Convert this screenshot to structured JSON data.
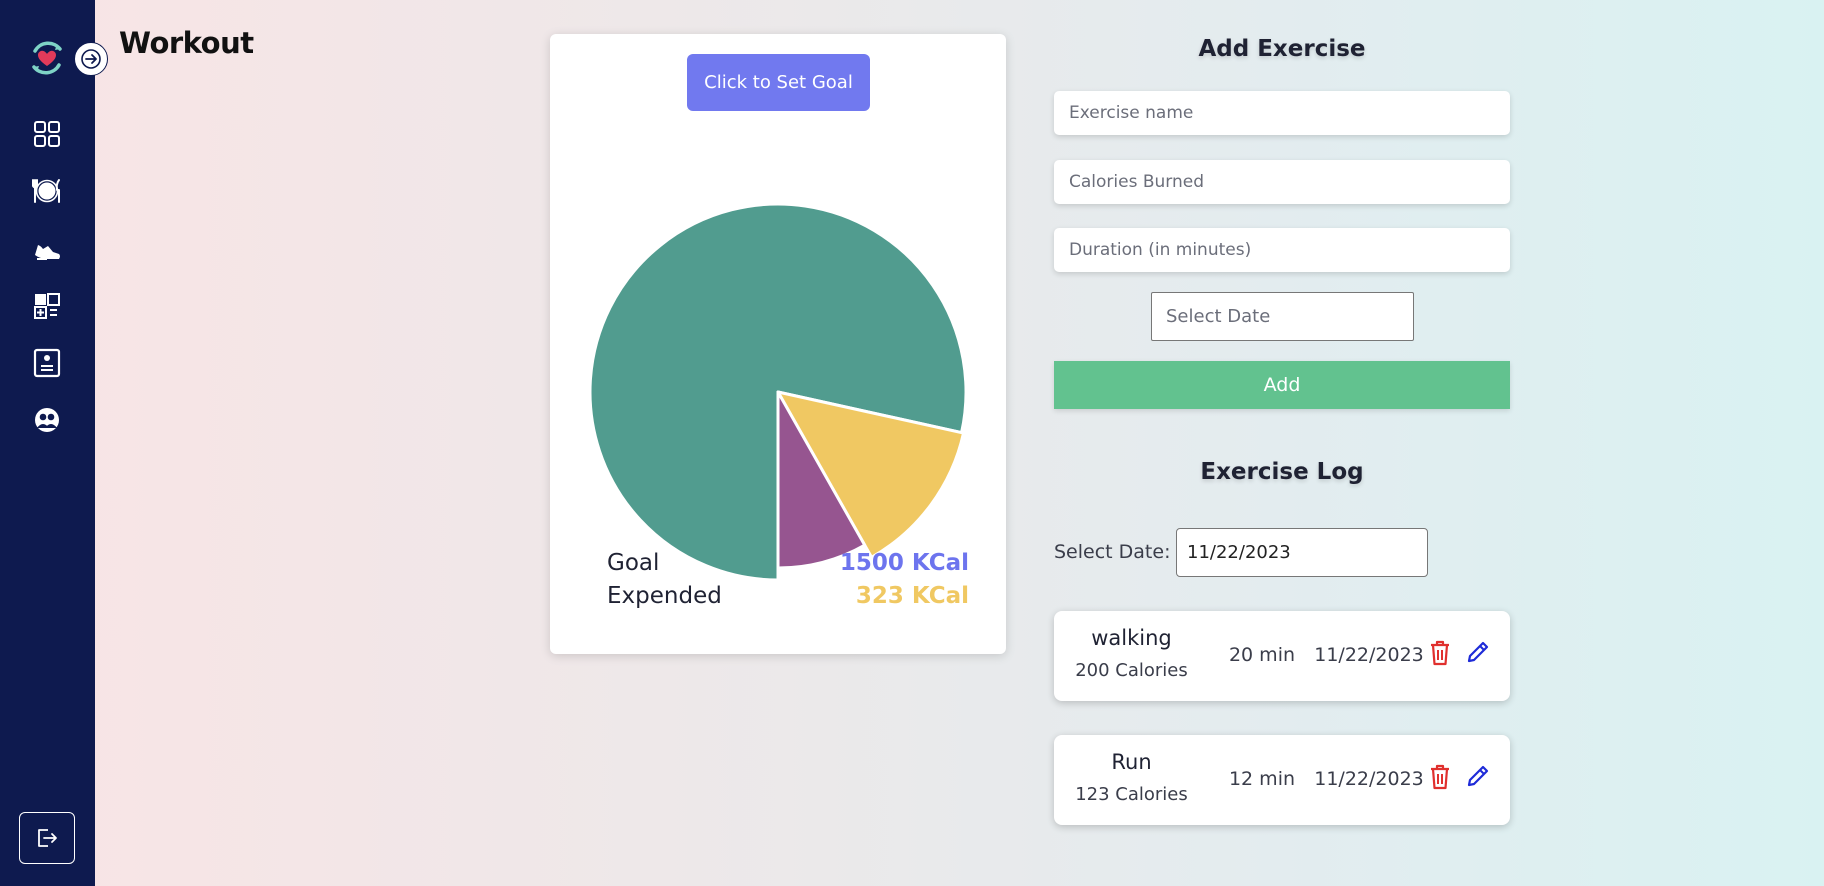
{
  "page": {
    "title": "Workout"
  },
  "sidebar": {
    "items": [
      {
        "name": "dashboard",
        "icon": "grid-icon"
      },
      {
        "name": "meals",
        "icon": "plate-cutlery-icon"
      },
      {
        "name": "workout",
        "icon": "sneaker-icon"
      },
      {
        "name": "calculator",
        "icon": "calculator-icon"
      },
      {
        "name": "profile",
        "icon": "id-card-icon"
      },
      {
        "name": "community",
        "icon": "group-icon"
      }
    ],
    "logout_icon": "logout-icon",
    "background": "#0e1a4f"
  },
  "goal_card": {
    "button_label": "Click to Set Goal",
    "goal_label": "Goal",
    "goal_value": "1500 KCal",
    "expended_label": "Expended",
    "expended_value": "323 KCal",
    "goal_color": "#6d74ee",
    "expended_color": "#f0c862"
  },
  "chart_data": {
    "type": "pie",
    "slices": [
      {
        "value": 1177,
        "color": "#519c8f"
      },
      {
        "value": 200,
        "color": "#f0c862"
      },
      {
        "value": 123,
        "color": "#965590"
      }
    ]
  },
  "add_exercise": {
    "title": "Add Exercise",
    "name_placeholder": "Exercise name",
    "calories_placeholder": "Calories Burned",
    "duration_placeholder": "Duration (in minutes)",
    "date_placeholder": "Select Date",
    "add_label": "Add"
  },
  "exercise_log": {
    "title": "Exercise Log",
    "date_label": "Select Date:",
    "date_value": "11/22/2023",
    "entries": [
      {
        "name": "walking",
        "calories": "200 Calories",
        "duration": "20 min",
        "date": "11/22/2023"
      },
      {
        "name": "Run",
        "calories": "123 Calories",
        "duration": "12 min",
        "date": "11/22/2023"
      }
    ]
  }
}
